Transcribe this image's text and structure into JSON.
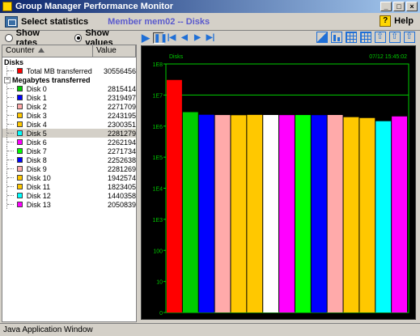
{
  "window": {
    "title": "Group Manager Performance Monitor",
    "buttons": [
      "_",
      "□",
      "×"
    ]
  },
  "toolbar": {
    "select_label": "Select statistics",
    "member_title": "Member mem02 -- Disks",
    "help_label": "Help",
    "help_glyph": "?"
  },
  "view_mode": {
    "rates_label": "Show rates",
    "values_label": "Show values",
    "selected": "values"
  },
  "list": {
    "headers": {
      "counter": "Counter",
      "value": "Value"
    },
    "group1": {
      "label": "Disks",
      "items": [
        {
          "label": "Total MB transferred",
          "value": "30556456",
          "color": "#ff0000"
        }
      ]
    },
    "group2": {
      "label": "Megabytes transferred",
      "items": [
        {
          "label": "Disk 0",
          "value": "2815414",
          "color": "#00cc00"
        },
        {
          "label": "Disk 1",
          "value": "2319497",
          "color": "#0000ff"
        },
        {
          "label": "Disk 2",
          "value": "2271709",
          "color": "#ffaaaa"
        },
        {
          "label": "Disk 3",
          "value": "2243195",
          "color": "#ffc800"
        },
        {
          "label": "Disk 4",
          "value": "2300351",
          "color": "#ffc800"
        },
        {
          "label": "Disk 5",
          "value": "2281279",
          "color": "#00ffff",
          "selected": true
        },
        {
          "label": "Disk 6",
          "value": "2262194",
          "color": "#ff00ff"
        },
        {
          "label": "Disk 7",
          "value": "2271734",
          "color": "#00ff00"
        },
        {
          "label": "Disk 8",
          "value": "2252638",
          "color": "#0000ff"
        },
        {
          "label": "Disk 9",
          "value": "2281269",
          "color": "#ffaaaa"
        },
        {
          "label": "Disk 10",
          "value": "1942574",
          "color": "#ffc800"
        },
        {
          "label": "Disk 11",
          "value": "1823405",
          "color": "#ffc800"
        },
        {
          "label": "Disk 12",
          "value": "1440358",
          "color": "#00ffff"
        },
        {
          "label": "Disk 13",
          "value": "2050839",
          "color": "#ff00ff"
        }
      ]
    }
  },
  "chart_toolbar": {
    "buttons": [
      "play",
      "pause",
      "first",
      "prev",
      "next",
      "last"
    ],
    "glyphs": [
      "▶",
      "❚❚",
      "|◀",
      "◀",
      "▶",
      "▶|"
    ]
  },
  "chart_data": {
    "type": "bar",
    "title": "Disks",
    "timestamp": "07/12 15:45:02",
    "yscale": "log",
    "ylim": [
      1,
      100000000
    ],
    "ytick_values": [
      1,
      10,
      100,
      1000,
      10000,
      100000,
      1000000,
      10000000,
      100000000
    ],
    "ytick_labels": [
      "0",
      "10",
      "100",
      "1E3",
      "1E4",
      "1E5",
      "1E6",
      "1E7",
      "1E8"
    ],
    "categories": [
      "Total MB transferred",
      "Disk 0",
      "Disk 1",
      "Disk 2",
      "Disk 3",
      "Disk 4",
      "Disk 5",
      "Disk 6",
      "Disk 7",
      "Disk 8",
      "Disk 9",
      "Disk 10",
      "Disk 11",
      "Disk 12",
      "Disk 13"
    ],
    "values": [
      30556456,
      2815414,
      2319497,
      2271709,
      2243195,
      2300351,
      2281279,
      2262194,
      2271734,
      2252638,
      2281269,
      1942574,
      1823405,
      1440358,
      2050839
    ],
    "colors": [
      "#ff0000",
      "#00cc00",
      "#0000ff",
      "#ffaaaa",
      "#ffc800",
      "#ffc800",
      "#ffffff",
      "#ff00ff",
      "#00ff00",
      "#0000ff",
      "#ffaaaa",
      "#ffc800",
      "#ffc800",
      "#00ffff",
      "#ff00ff"
    ],
    "grid_color": "#00cc00",
    "text_color": "#00cc00"
  },
  "statusbar": {
    "text": "Java Application Window"
  }
}
